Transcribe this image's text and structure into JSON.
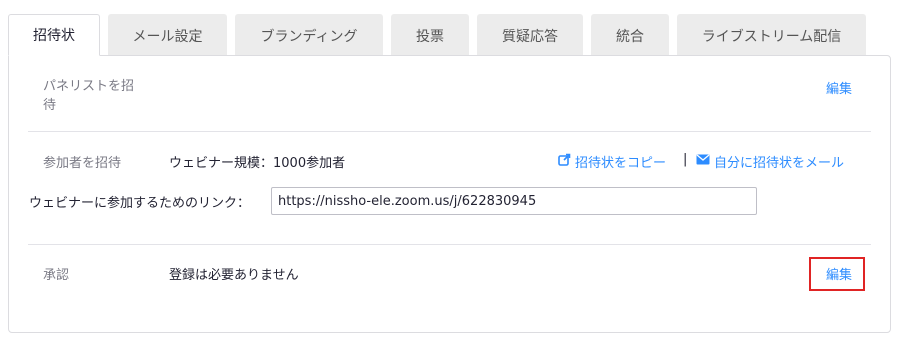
{
  "tabs": [
    {
      "label": "招待状"
    },
    {
      "label": "メール設定"
    },
    {
      "label": "ブランディング"
    },
    {
      "label": "投票"
    },
    {
      "label": "質疑応答"
    },
    {
      "label": "統合"
    },
    {
      "label": "ライブストリーム配信"
    }
  ],
  "panelists": {
    "label_line1": "パネリストを招",
    "label_line2": "待",
    "edit_label": "編集"
  },
  "invite_attendees": {
    "label": "参加者を招待",
    "webinar_size": "ウェビナー規模：1000参加者",
    "copy_link_label": "招待状をコピー",
    "separator": "|",
    "email_self_label": "自分に招待状をメール",
    "join_link_label": "ウェビナーに参加するためのリンク：",
    "join_link_value": "https://nissho-ele.zoom.us/j/622830945"
  },
  "approval": {
    "label": "承認",
    "value": "登録は必要ありません",
    "edit_label": "編集"
  },
  "colors": {
    "link": "#2d8cff",
    "highlight": "#e02424"
  }
}
